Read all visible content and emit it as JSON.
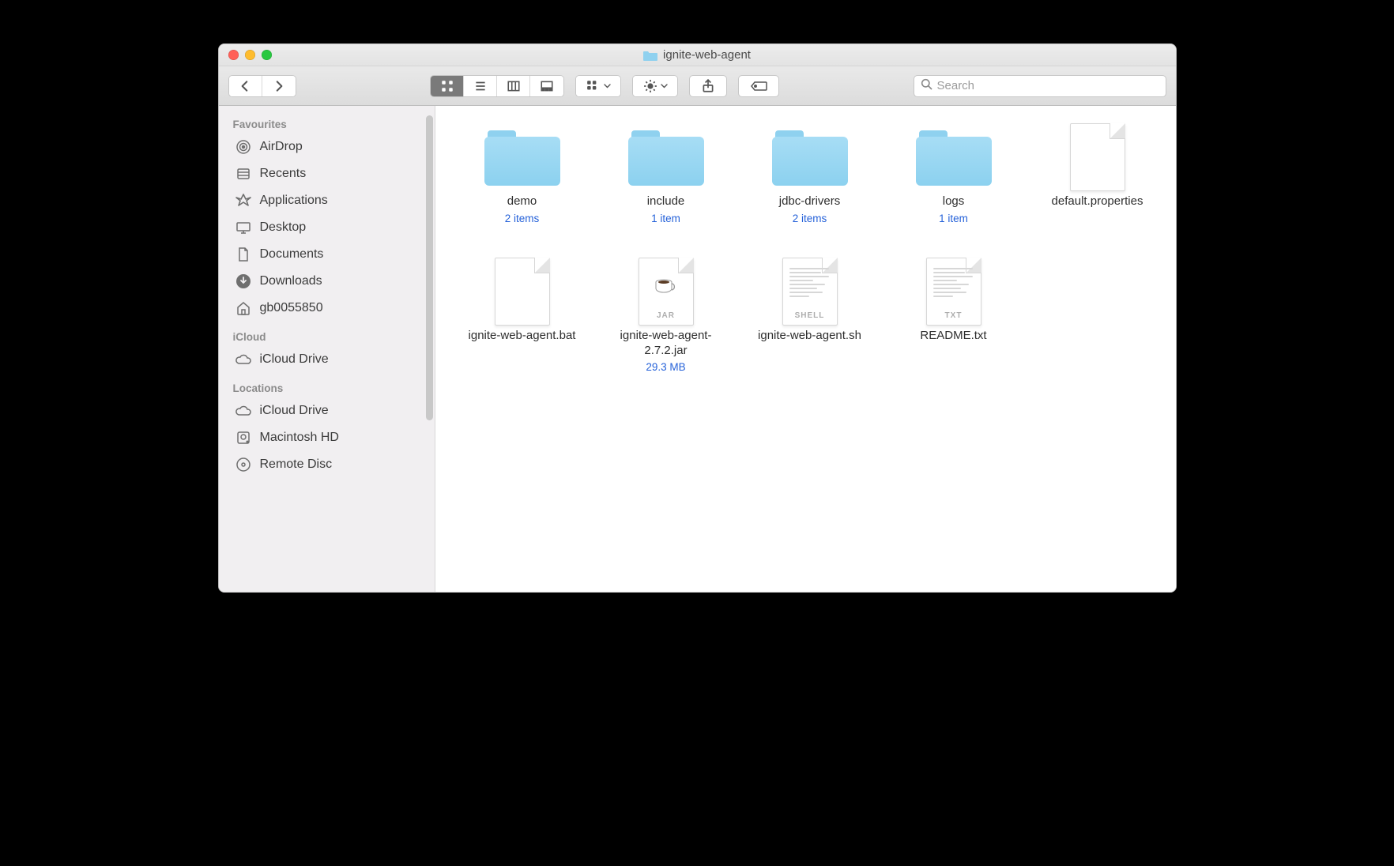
{
  "window": {
    "title": "ignite-web-agent"
  },
  "toolbar": {
    "search_placeholder": "Search"
  },
  "sidebar": {
    "sections": [
      {
        "header": "Favourites",
        "items": [
          {
            "id": "airdrop",
            "label": "AirDrop",
            "icon": "airdrop"
          },
          {
            "id": "recents",
            "label": "Recents",
            "icon": "recents"
          },
          {
            "id": "applications",
            "label": "Applications",
            "icon": "apps"
          },
          {
            "id": "desktop",
            "label": "Desktop",
            "icon": "desktop"
          },
          {
            "id": "documents",
            "label": "Documents",
            "icon": "documents"
          },
          {
            "id": "downloads",
            "label": "Downloads",
            "icon": "downloads"
          },
          {
            "id": "home",
            "label": "gb0055850",
            "icon": "home"
          }
        ]
      },
      {
        "header": "iCloud",
        "items": [
          {
            "id": "iclouddrive1",
            "label": "iCloud Drive",
            "icon": "cloud"
          }
        ]
      },
      {
        "header": "Locations",
        "items": [
          {
            "id": "iclouddrive2",
            "label": "iCloud Drive",
            "icon": "cloud"
          },
          {
            "id": "macintoshhd",
            "label": "Macintosh HD",
            "icon": "hdd"
          },
          {
            "id": "remotedisc",
            "label": "Remote Disc",
            "icon": "disc"
          }
        ]
      }
    ]
  },
  "files": [
    {
      "name": "demo",
      "kind": "folder",
      "sub": "2 items"
    },
    {
      "name": "include",
      "kind": "folder",
      "sub": "1 item"
    },
    {
      "name": "jdbc-drivers",
      "kind": "folder",
      "sub": "2 items"
    },
    {
      "name": "logs",
      "kind": "folder",
      "sub": "1 item"
    },
    {
      "name": "default.properties",
      "kind": "file",
      "sub": "",
      "badge": ""
    },
    {
      "name": "ignite-web-agent.bat",
      "kind": "file",
      "sub": "",
      "badge": ""
    },
    {
      "name": "ignite-web-agent-2.7.2.jar",
      "kind": "jar",
      "sub": "29.3 MB",
      "badge": "JAR"
    },
    {
      "name": "ignite-web-agent.sh",
      "kind": "text",
      "sub": "",
      "badge": "SHELL"
    },
    {
      "name": "README.txt",
      "kind": "text",
      "sub": "",
      "badge": "TXT"
    }
  ]
}
